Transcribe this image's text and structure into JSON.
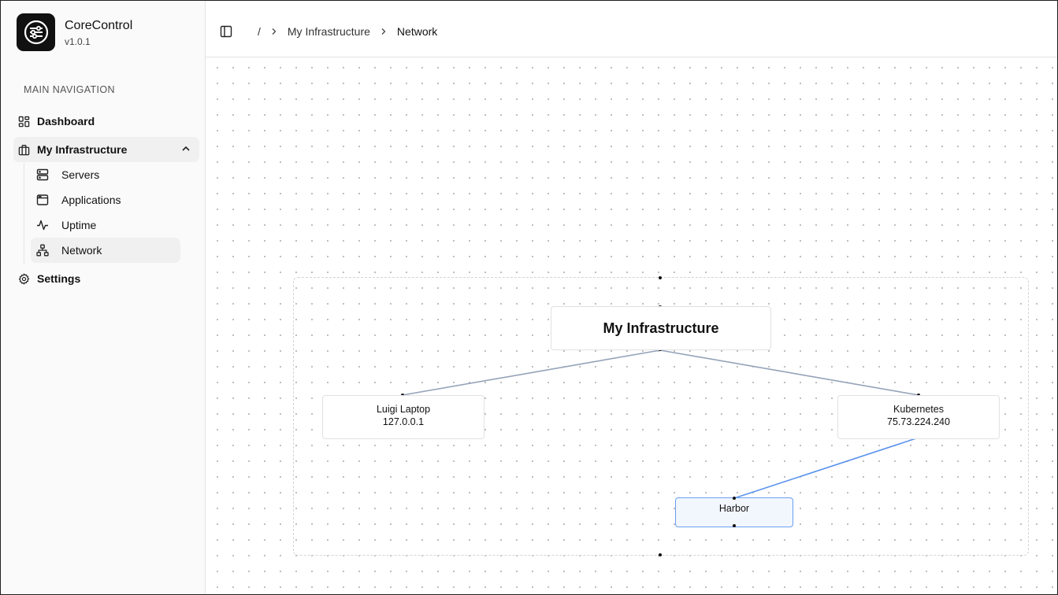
{
  "app": {
    "name": "CoreControl",
    "version": "v1.0.1"
  },
  "sidebar": {
    "group_label": "MAIN NAVIGATION",
    "items": [
      {
        "label": "Dashboard",
        "icon": "dashboard-icon"
      },
      {
        "label": "My Infrastructure",
        "icon": "briefcase-icon",
        "expanded": true
      },
      {
        "label": "Settings",
        "icon": "gear-icon"
      }
    ],
    "subitems": [
      {
        "label": "Servers",
        "icon": "server-icon"
      },
      {
        "label": "Applications",
        "icon": "app-window-icon"
      },
      {
        "label": "Uptime",
        "icon": "activity-icon"
      },
      {
        "label": "Network",
        "icon": "network-icon",
        "active": true
      }
    ]
  },
  "header": {
    "breadcrumb": {
      "root": "/",
      "parent": "My Infrastructure",
      "current": "Network"
    }
  },
  "network": {
    "root": {
      "label": "My Infrastructure"
    },
    "servers": [
      {
        "name": "Luigi Laptop",
        "ip": "127.0.0.1"
      },
      {
        "name": "Kubernetes",
        "ip": "75.73.224.240"
      }
    ],
    "applications": [
      {
        "name": "Harbor",
        "server": "Kubernetes"
      }
    ],
    "colors": {
      "server_edge": "#94a3b8",
      "app_edge": "#5b93ec",
      "app_border": "#6aa0f0",
      "app_fill": "#f2f6fd"
    }
  }
}
